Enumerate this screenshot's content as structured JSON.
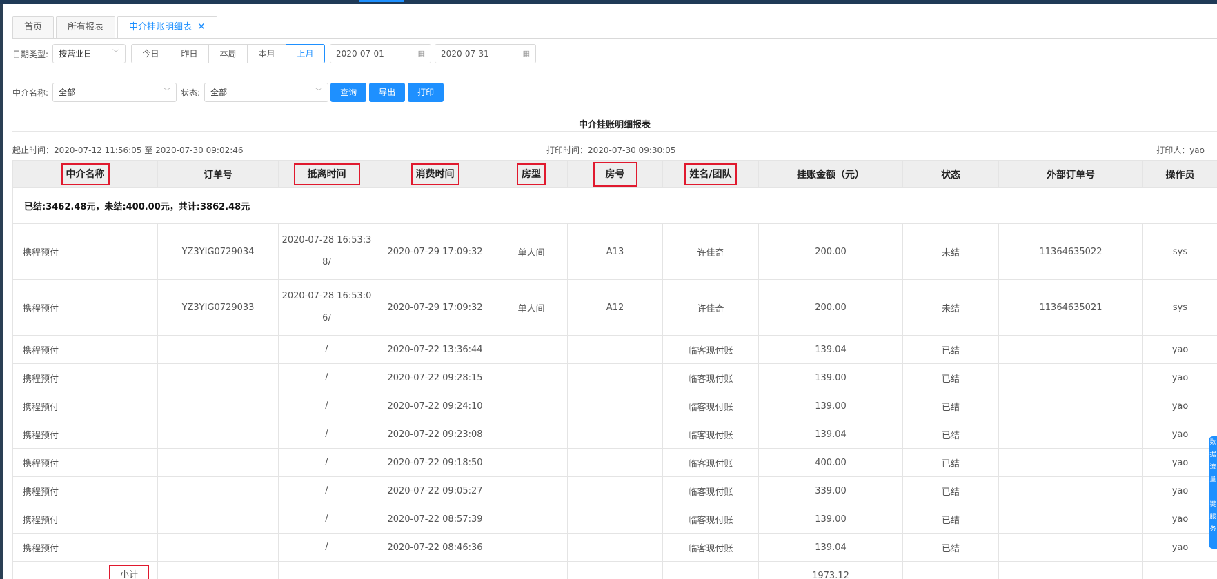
{
  "tabs": [
    {
      "label": "首页",
      "active": false
    },
    {
      "label": "所有报表",
      "active": false
    },
    {
      "label": "中介挂账明细表",
      "active": true
    }
  ],
  "tab_close_glyph": "✕",
  "filters": {
    "date_type_label": "日期类型:",
    "date_type_value": "按营业日",
    "quick_ranges": [
      "今日",
      "昨日",
      "本周",
      "本月",
      "上月"
    ],
    "active_range": "上月",
    "start_date": "2020-07-01",
    "end_date": "2020-07-31",
    "agent_label": "中介名称:",
    "agent_value": "全部",
    "status_label": "状态:",
    "status_value": "全部",
    "query_label": "查询",
    "export_label": "导出",
    "print_label": "打印"
  },
  "report": {
    "title": "中介挂账明细报表",
    "range": "起止时间：2020-07-12 11:56:05 至 2020-07-30 09:02:46",
    "print_time": "打印时间：2020-07-30 09:30:05",
    "printer": "打印人：yao"
  },
  "table": {
    "headers": [
      "中介名称",
      "订单号",
      "抵离时间",
      "消费时间",
      "房型",
      "房号",
      "姓名/团队",
      "挂账金额（元）",
      "状态",
      "外部订单号",
      "操作员"
    ],
    "summary": "已结:3462.48元，未结:400.00元，共计:3862.48元",
    "rows": [
      [
        "携程预付",
        "YZ3YIG0729034",
        "2020-07-28 16:53:38/",
        "2020-07-29 17:09:32",
        "单人间",
        "A13",
        "许佳奇",
        "200.00",
        "未结",
        "11364635022",
        "sys"
      ],
      [
        "携程预付",
        "YZ3YIG0729033",
        "2020-07-28 16:53:06/",
        "2020-07-29 17:09:32",
        "单人间",
        "A12",
        "许佳奇",
        "200.00",
        "未结",
        "11364635021",
        "sys"
      ],
      [
        "携程预付",
        "",
        "/",
        "2020-07-22 13:36:44",
        "",
        "",
        "临客现付账",
        "139.04",
        "已结",
        "",
        "yao"
      ],
      [
        "携程预付",
        "",
        "/",
        "2020-07-22 09:28:15",
        "",
        "",
        "临客现付账",
        "139.00",
        "已结",
        "",
        "yao"
      ],
      [
        "携程预付",
        "",
        "/",
        "2020-07-22 09:24:10",
        "",
        "",
        "临客现付账",
        "139.00",
        "已结",
        "",
        "yao"
      ],
      [
        "携程预付",
        "",
        "/",
        "2020-07-22 09:23:08",
        "",
        "",
        "临客现付账",
        "139.04",
        "已结",
        "",
        "yao"
      ],
      [
        "携程预付",
        "",
        "/",
        "2020-07-22 09:18:50",
        "",
        "",
        "临客现付账",
        "400.00",
        "已结",
        "",
        "yao"
      ],
      [
        "携程预付",
        "",
        "/",
        "2020-07-22 09:05:27",
        "",
        "",
        "临客现付账",
        "339.00",
        "已结",
        "",
        "yao"
      ],
      [
        "携程预付",
        "",
        "/",
        "2020-07-22 08:57:39",
        "",
        "",
        "临客现付账",
        "139.00",
        "已结",
        "",
        "yao"
      ],
      [
        "携程预付",
        "",
        "/",
        "2020-07-22 08:46:36",
        "",
        "",
        "临客现付账",
        "139.04",
        "已结",
        "",
        "yao"
      ]
    ],
    "subtotal_label": "小计",
    "subtotal_amount": "1973.12"
  },
  "side_float_text": "数据流量一键服务",
  "colors": {
    "accent": "#1e90ff",
    "highlight_box": "#e0192e",
    "topbar": "#1f3a57"
  }
}
